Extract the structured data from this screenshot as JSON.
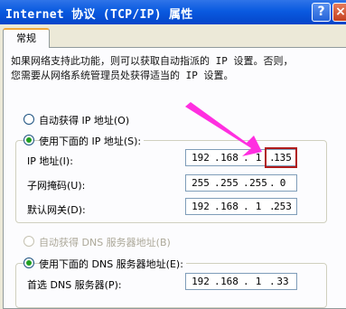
{
  "window": {
    "title": "Internet 协议 (TCP/IP) 属性",
    "help_label": "?",
    "close_label": "×"
  },
  "tabs": [
    {
      "label": "常规"
    }
  ],
  "intro": {
    "line1": "如果网络支持此功能，则可以获取自动指派的 IP 设置。否则，",
    "line2": "您需要从网络系统管理员处获得适当的 IP 设置。"
  },
  "ip_mode": {
    "auto_label": "自动获得 IP 地址(O)",
    "manual_label": "使用下面的 IP 地址(S):",
    "selected": "manual"
  },
  "ip_fields": {
    "ip_address": {
      "label": "IP 地址(I):",
      "octets": [
        "192",
        "168",
        "1",
        "135"
      ]
    },
    "subnet_mask": {
      "label": "子网掩码(U):",
      "octets": [
        "255",
        "255",
        "255",
        "0"
      ]
    },
    "gateway": {
      "label": "默认网关(D):",
      "octets": [
        "192",
        "168",
        "1",
        "253"
      ]
    }
  },
  "dns_mode": {
    "auto_label": "自动获得 DNS 服务器地址(B)",
    "manual_label": "使用下面的 DNS 服务器地址(E):",
    "selected": "manual"
  },
  "dns_fields": {
    "preferred": {
      "label": "首选 DNS 服务器(P):",
      "octets": [
        "192",
        "168",
        "1",
        "33"
      ]
    }
  },
  "annotation": {
    "arrow_color": "#ff2fe0",
    "box_color": "#b01b1b"
  }
}
